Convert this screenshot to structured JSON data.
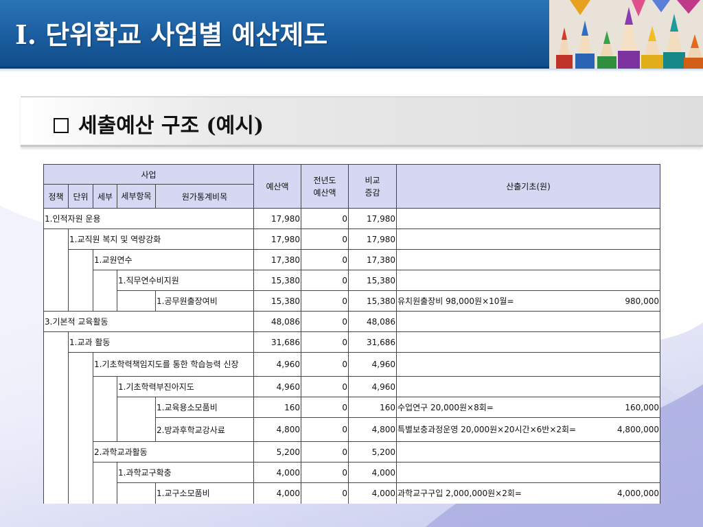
{
  "slide": {
    "title": "Ⅰ. 단위학교 사업별 예산제도",
    "subtitle": "세출예산 구조 (예시)"
  },
  "colors": {
    "header_blue": "#1a5d9f",
    "table_header_bg": "#d6d7f2",
    "table_border": "#444444"
  },
  "table": {
    "headers": {
      "business": "사업",
      "budget": "예산액",
      "prev_budget": "전년도\n예산액",
      "diff": "비교\n증감",
      "basis": "산출기초(원)",
      "policy": "정책",
      "unit": "단위",
      "detail": "세부",
      "sub_item": "세부항목",
      "cost_account": "원가통계비목"
    },
    "rows": [
      {
        "label": "1.인적자원 운용",
        "budget": "17,980",
        "prev": "0",
        "diff": "17,980",
        "calc": "",
        "amount": ""
      },
      {
        "label": "1.교직원 복지 및 역량강화",
        "budget": "17,980",
        "prev": "0",
        "diff": "17,980",
        "calc": "",
        "amount": ""
      },
      {
        "label": "1.교원연수",
        "budget": "17,380",
        "prev": "0",
        "diff": "17,380",
        "calc": "",
        "amount": ""
      },
      {
        "label": "1.직무연수비지원",
        "budget": "15,380",
        "prev": "0",
        "diff": "15,380",
        "calc": "",
        "amount": ""
      },
      {
        "label": "1.공무원출장여비",
        "budget": "15,380",
        "prev": "0",
        "diff": "15,380",
        "calc": "유치원출장비  98,000원×10월=",
        "amount": "980,000"
      },
      {
        "label": "3.기본적 교육활동",
        "budget": "48,086",
        "prev": "0",
        "diff": "48,086",
        "calc": "",
        "amount": ""
      },
      {
        "label": "1.교과 활동",
        "budget": "31,686",
        "prev": "0",
        "diff": "31,686",
        "calc": "",
        "amount": ""
      },
      {
        "label": "1.기초학력책임지도를 통한 학습능력 신장",
        "budget": "4,960",
        "prev": "0",
        "diff": "4,960",
        "calc": "",
        "amount": ""
      },
      {
        "label": "1.기초학력부진아지도",
        "budget": "4,960",
        "prev": "0",
        "diff": "4,960",
        "calc": "",
        "amount": ""
      },
      {
        "label": "1.교육용소모품비",
        "budget": "160",
        "prev": "0",
        "diff": "160",
        "calc": "수업연구  20,000원×8회=",
        "amount": "160,000"
      },
      {
        "label": "2.방과후학교강사료",
        "budget": "4,800",
        "prev": "0",
        "diff": "4,800",
        "calc": "특별보충과정운영  20,000원×20시간×6반×2회=",
        "amount": "4,800,000"
      },
      {
        "label": "2.과학교과활동",
        "budget": "5,200",
        "prev": "0",
        "diff": "5,200",
        "calc": "",
        "amount": ""
      },
      {
        "label": "1.과학교구확충",
        "budget": "4,000",
        "prev": "0",
        "diff": "4,000",
        "calc": "",
        "amount": ""
      },
      {
        "label": "1.교구소모품비",
        "budget": "4,000",
        "prev": "0",
        "diff": "4,000",
        "calc": "과학교구구입  2,000,000원×2회=",
        "amount": "4,000,000"
      }
    ]
  }
}
